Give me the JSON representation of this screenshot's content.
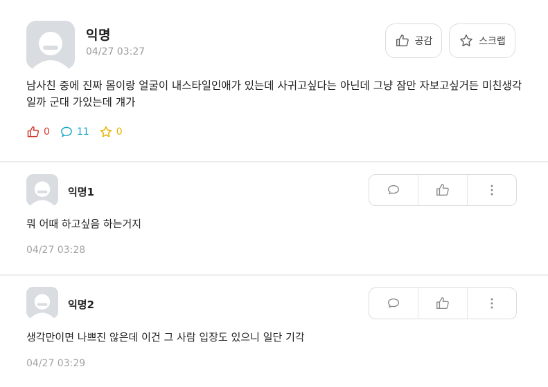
{
  "post": {
    "author": "익명",
    "time": "04/27 03:27",
    "like_button_label": "공감",
    "scrap_button_label": "스크랩",
    "body": "남사친 중에 진짜 몸이랑 얼굴이 내스타일인애가 있는데 사귀고싶다는 아닌데 그냥 잠만 자보고싶거든 미친생각일까 군대 가있는데 걔가",
    "stats": {
      "likes": "0",
      "comments": "11",
      "scraps": "0"
    }
  },
  "comments": [
    {
      "author": "익명1",
      "body": "뭐 어때 하고싶음 하는거지",
      "time": "04/27 03:28"
    },
    {
      "author": "익명2",
      "body": "생각만이면 나쁘진 않은데 이건 그 사람 입장도 있으니 일단 기각",
      "time": "04/27 03:29"
    }
  ],
  "colors": {
    "like_red": "#d23a2e",
    "comment_blue": "#1aa7c9",
    "scrap_yellow": "#e5b300",
    "avatar_bg": "#d9dde2"
  },
  "icons": {
    "like": "thumbs-up-icon",
    "scrap": "star-icon",
    "comment": "speech-bubble-icon",
    "more": "more-vertical-icon"
  }
}
